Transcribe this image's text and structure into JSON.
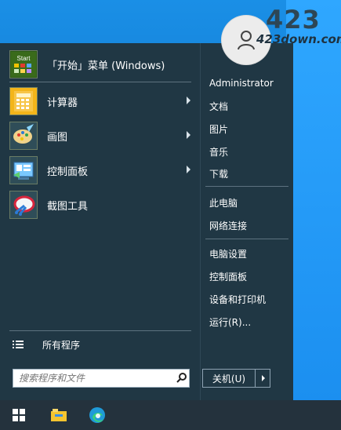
{
  "watermark": {
    "big": "423",
    "small": "423down.com"
  },
  "apps": [
    {
      "label": "「开始」菜单 (Windows)",
      "icon": "start-menu-icon"
    },
    {
      "label": "计算器",
      "icon": "calculator-icon"
    },
    {
      "label": "画图",
      "icon": "paint-icon"
    },
    {
      "label": "控制面板",
      "icon": "control-panel-icon"
    },
    {
      "label": "截图工具",
      "icon": "snipping-tool-icon"
    }
  ],
  "all_programs": "所有程序",
  "search": {
    "placeholder": "搜索程序和文件"
  },
  "right_items": [
    "Administrator",
    "文档",
    "图片",
    "音乐",
    "下载",
    "此电脑",
    "网络连接",
    "电脑设置",
    "控制面板",
    "设备和打印机",
    "运行(R)..."
  ],
  "shutdown": {
    "label": "关机(U)"
  },
  "taskbar": {
    "icons": [
      "windows-start-icon",
      "file-explorer-icon",
      "edge-icon"
    ]
  }
}
